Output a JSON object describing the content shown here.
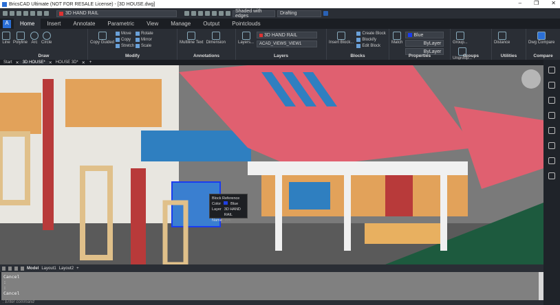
{
  "title": "BricsCAD Ultimate (NOT FOR RESALE License) - [3D HOUSE.dwg]",
  "qat": {
    "layer": "3D HAND RAIL",
    "visual_style": "Shaded with edges",
    "workspace": "Drafting"
  },
  "tabs": [
    "Home",
    "Insert",
    "Annotate",
    "Parametric",
    "View",
    "Manage",
    "Output",
    "Pointclouds"
  ],
  "ribbon": {
    "draw": {
      "title": "Draw",
      "items": [
        "Line",
        "Polyline",
        "Arc",
        "Circle"
      ]
    },
    "modify": {
      "title": "Modify",
      "items": [
        "Move",
        "Copy",
        "Stretch",
        "Rotate",
        "Mirror",
        "Scale"
      ],
      "copy_guided": "Copy Guided"
    },
    "annotations": {
      "title": "Annotations",
      "items": [
        "Multiline Text",
        "Dimension"
      ]
    },
    "layers": {
      "title": "Layers",
      "layers_label": "Layers...",
      "current_layer": "3D HAND RAIL",
      "view_layer": "ACAD_VIEWS_VIEW1"
    },
    "blocks": {
      "title": "Blocks",
      "insert": "Insert Block...",
      "items": [
        "Create Block",
        "Blockify",
        "Edit Block"
      ]
    },
    "properties": {
      "title": "Properties",
      "match": "Match",
      "color": "Blue",
      "linetype": "ByLayer",
      "lineweight": "ByLayer"
    },
    "groups": {
      "title": "Groups",
      "items": [
        "Group...",
        "Ungroup..."
      ]
    },
    "utilities": {
      "title": "Utilities",
      "items": [
        "Distance"
      ]
    },
    "compare": {
      "title": "Compare",
      "items": [
        "Dwg Compare"
      ]
    }
  },
  "doc_tabs": [
    "Start",
    "3D HOUSE*",
    "HOUSE 3D*"
  ],
  "layout_tabs": [
    "Model",
    "Layout1",
    "Layout2"
  ],
  "tooltip": {
    "title": "Block Reference",
    "color_label": "Color",
    "color": "Blue",
    "layer_label": "Layer",
    "layer": "3D HAND RAIL",
    "name_label": "Name",
    "name": "W4"
  },
  "command_history": [
    "Cancel",
    ":",
    ":",
    "Cancel"
  ],
  "command_prompt": ": Enter command",
  "colors": {
    "accent": "#2b6fd6",
    "roof": "#e06070",
    "wall": "#e8e6e0",
    "brick": "#b83a3a",
    "ground": "#1d5a3e"
  }
}
